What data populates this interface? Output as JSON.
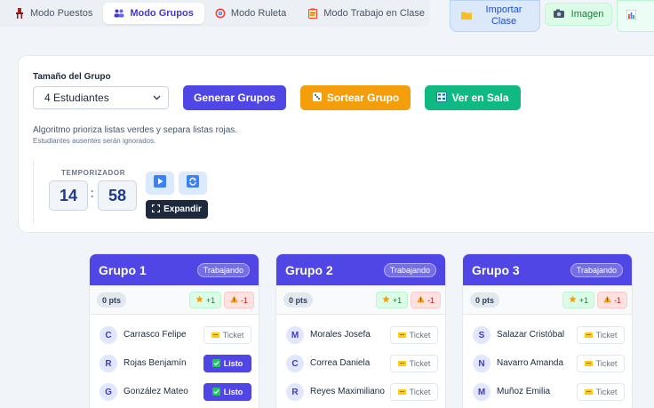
{
  "modes": [
    {
      "label": "Modo Puestos",
      "icon": "puestos-icon",
      "active": false
    },
    {
      "label": "Modo Grupos",
      "icon": "groups-icon",
      "active": true
    },
    {
      "label": "Modo Ruleta",
      "icon": "target-icon",
      "active": false
    },
    {
      "label": "Modo Trabajo en Clase",
      "icon": "clipboard-icon",
      "active": false
    }
  ],
  "actions": {
    "import_label": "Importar Clase",
    "image_label": "Imagen"
  },
  "controls": {
    "size_label": "Tamaño del Grupo",
    "size_value": "4 Estudiantes",
    "generate_label": "Generar Grupos",
    "draw_label": "Sortear Grupo",
    "room_label": "Ver en Sala",
    "algorithm_note": "Algoritmo prioriza listas verdes y separa listas rojas.",
    "absent_note": "Estudiantes ausentes serán ignorados."
  },
  "timer": {
    "label": "TEMPORIZADOR",
    "minutes": "14",
    "seconds": "58",
    "separator": ":",
    "expand_label": "Expandir"
  },
  "groups": [
    {
      "title": "Grupo 1",
      "status": "Trabajando",
      "points": "0 pts",
      "plus": "+1",
      "minus": "-1",
      "students": [
        {
          "initial": "C",
          "name": "Carrasco Felipe",
          "action": "Ticket"
        },
        {
          "initial": "R",
          "name": "Rojas Benjamín",
          "action": "Listo"
        },
        {
          "initial": "G",
          "name": "González Mateo",
          "action": "Listo"
        }
      ]
    },
    {
      "title": "Grupo 2",
      "status": "Trabajando",
      "points": "0 pts",
      "plus": "+1",
      "minus": "-1",
      "students": [
        {
          "initial": "M",
          "name": "Morales Josefa",
          "action": "Ticket"
        },
        {
          "initial": "C",
          "name": "Correa Daniela",
          "action": "Ticket"
        },
        {
          "initial": "R",
          "name": "Reyes Maximiliano",
          "action": "Ticket"
        }
      ]
    },
    {
      "title": "Grupo 3",
      "status": "Trabajando",
      "points": "0 pts",
      "plus": "+1",
      "minus": "-1",
      "students": [
        {
          "initial": "S",
          "name": "Salazar Cristóbal",
          "action": "Ticket"
        },
        {
          "initial": "N",
          "name": "Navarro Amanda",
          "action": "Ticket"
        },
        {
          "initial": "M",
          "name": "Muñoz Emilia",
          "action": "Ticket"
        }
      ]
    }
  ],
  "colors": {
    "primary": "#4f46e5",
    "warning": "#f59e0b",
    "success": "#10b981",
    "dark": "#1e293b"
  }
}
